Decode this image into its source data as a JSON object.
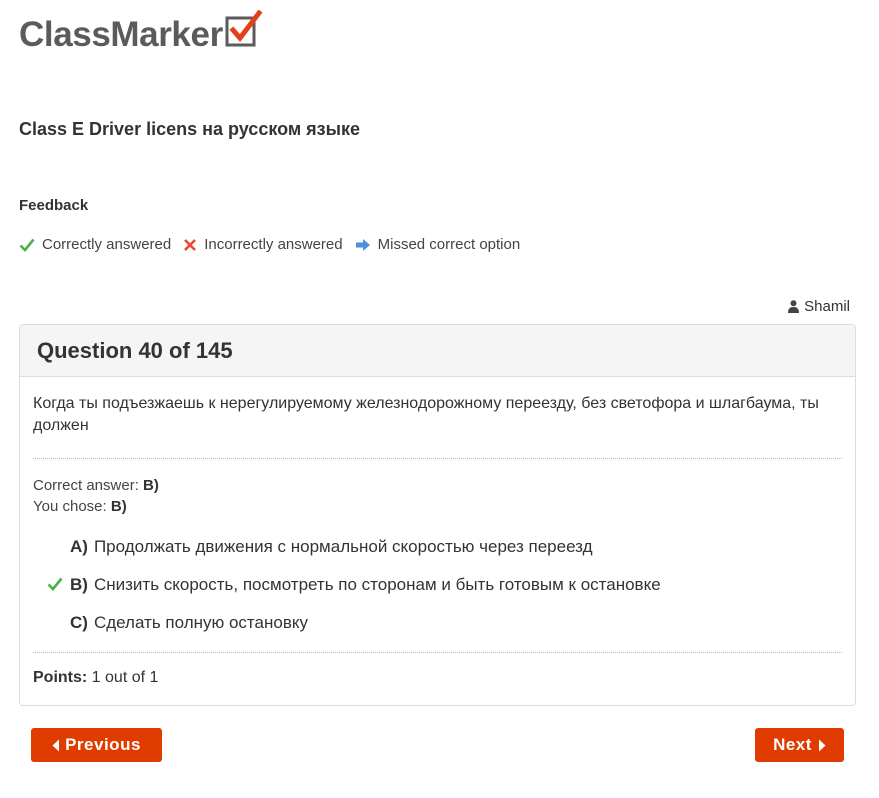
{
  "brand": {
    "name": "ClassMarker"
  },
  "quiz": {
    "title": "Class E Driver licens на русском языке"
  },
  "feedback": {
    "title": "Feedback",
    "legend": {
      "correct": "Correctly answered",
      "incorrect": "Incorrectly answered",
      "missed": "Missed correct option"
    }
  },
  "user": {
    "name": "Shamil"
  },
  "question": {
    "header": "Question 40 of 145",
    "text": "Когда ты подъезжаешь к нерегулируемому железнодорожному переезду, без светофора и шлагбаума, ты должен",
    "correct_answer_label": "Correct answer:",
    "correct_answer_value": "B)",
    "you_chose_label": "You chose:",
    "you_chose_value": "B)",
    "options": [
      {
        "letter": "A)",
        "text": "Продолжать движения с нормальной скоростью через переезд",
        "marked_correct": false
      },
      {
        "letter": "B)",
        "text": "Снизить скорость, посмотреть по сторонам и быть готовым к остановке",
        "marked_correct": true
      },
      {
        "letter": "C)",
        "text": "Сделать полную остановку",
        "marked_correct": false
      }
    ],
    "points_label": "Points:",
    "points_value": "1 out of 1"
  },
  "nav": {
    "previous_label": "Previous",
    "next_label": "Next"
  },
  "colors": {
    "correct_green": "#4cae4c",
    "incorrect_red": "#e8482d",
    "missed_blue": "#4a90e2",
    "button_orange": "#e03c00",
    "logo_check_red": "#e2401c"
  },
  "icons": {
    "correct": "check-icon",
    "incorrect": "cross-icon",
    "missed": "arrow-right-icon",
    "user": "user-icon",
    "prev": "caret-left-icon",
    "next": "caret-right-icon"
  }
}
